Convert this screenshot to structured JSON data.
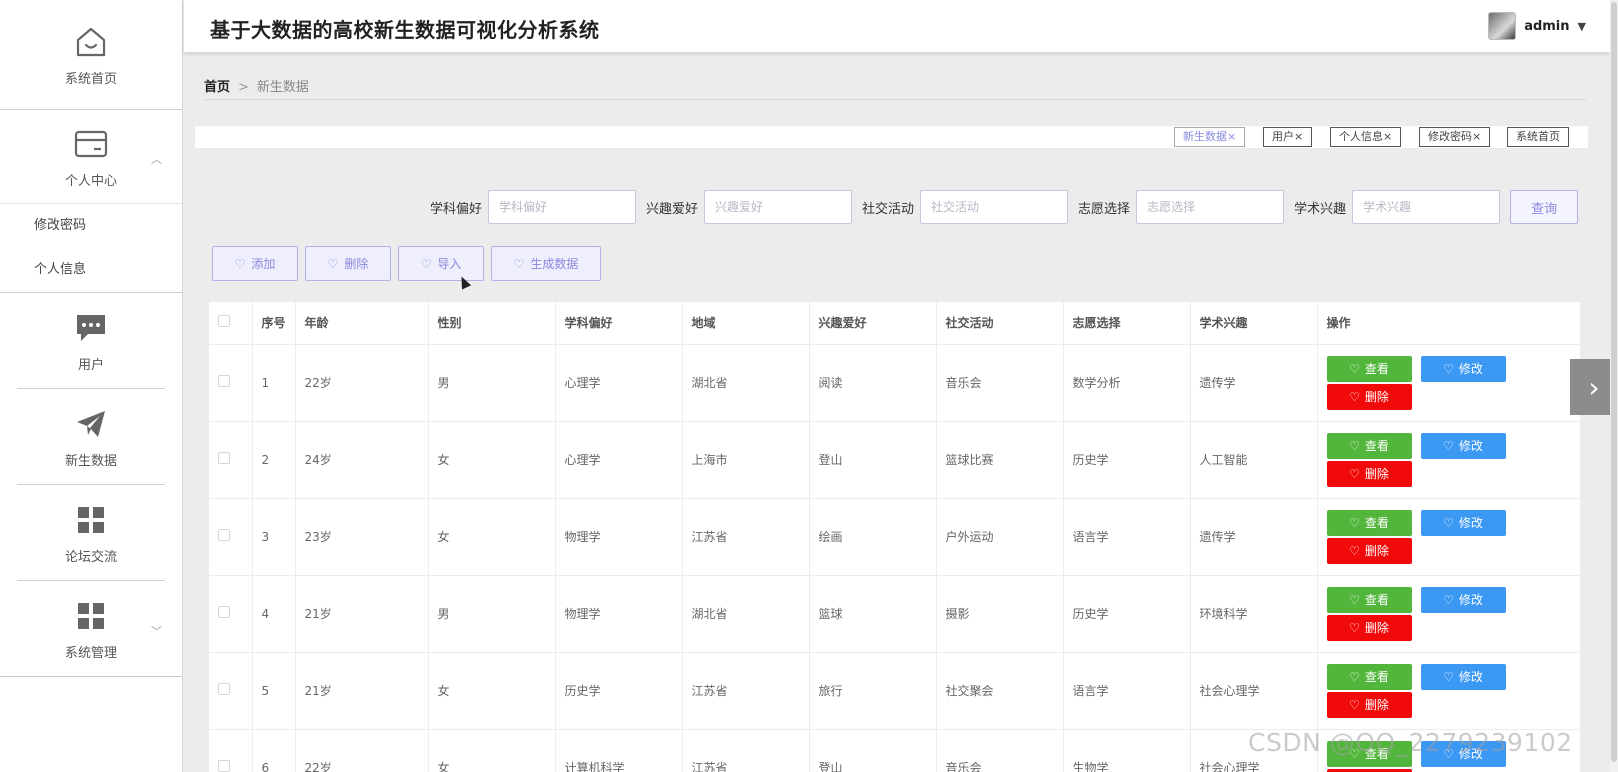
{
  "app": {
    "title": "基于大数据的高校新生数据可视化分析系统"
  },
  "user": {
    "name": "admin"
  },
  "sidebar": {
    "home": "系统首页",
    "personal": "个人中心",
    "personal_sub": [
      "修改密码",
      "个人信息"
    ],
    "user": "用户",
    "freshman": "新生数据",
    "forum": "论坛交流",
    "system": "系统管理"
  },
  "breadcrumb": {
    "home": "首页",
    "sep": ">",
    "current": "新生数据"
  },
  "tabs": [
    "新生数据×",
    "用户×",
    "个人信息×",
    "修改密码×",
    "系统首页"
  ],
  "search": {
    "fields": [
      {
        "label": "学科偏好",
        "placeholder": "学科偏好"
      },
      {
        "label": "兴趣爱好",
        "placeholder": "兴趣爱好"
      },
      {
        "label": "社交活动",
        "placeholder": "社交活动"
      },
      {
        "label": "志愿选择",
        "placeholder": "志愿选择"
      },
      {
        "label": "学术兴趣",
        "placeholder": "学术兴趣"
      }
    ],
    "button": "查询"
  },
  "actions": {
    "add": "添加",
    "delete": "删除",
    "import": "导入",
    "generate": "生成数据"
  },
  "table": {
    "headers": [
      "序号",
      "年龄",
      "性别",
      "学科偏好",
      "地域",
      "兴趣爱好",
      "社交活动",
      "志愿选择",
      "学术兴趣",
      "操作"
    ],
    "rows": [
      [
        "1",
        "22岁",
        "男",
        "心理学",
        "湖北省",
        "阅读",
        "音乐会",
        "数学分析",
        "遗传学"
      ],
      [
        "2",
        "24岁",
        "女",
        "心理学",
        "上海市",
        "登山",
        "篮球比赛",
        "历史学",
        "人工智能"
      ],
      [
        "3",
        "23岁",
        "女",
        "物理学",
        "江苏省",
        "绘画",
        "户外运动",
        "语言学",
        "遗传学"
      ],
      [
        "4",
        "21岁",
        "男",
        "物理学",
        "湖北省",
        "篮球",
        "摄影",
        "历史学",
        "环境科学"
      ],
      [
        "5",
        "21岁",
        "女",
        "历史学",
        "江苏省",
        "旅行",
        "社交聚会",
        "语言学",
        "社会心理学"
      ],
      [
        "6",
        "22岁",
        "女",
        "计算机科学",
        "江苏省",
        "登山",
        "音乐会",
        "生物学",
        "社会心理学"
      ]
    ],
    "op": {
      "view": "查看",
      "edit": "修改",
      "delete": "删除"
    }
  },
  "watermark": "CSDN @QQ_2279239102",
  "colors": {
    "view": "#53b63c",
    "edit": "#3b98f3",
    "delete": "#f00a0a",
    "accent": "#8a8ae0"
  }
}
